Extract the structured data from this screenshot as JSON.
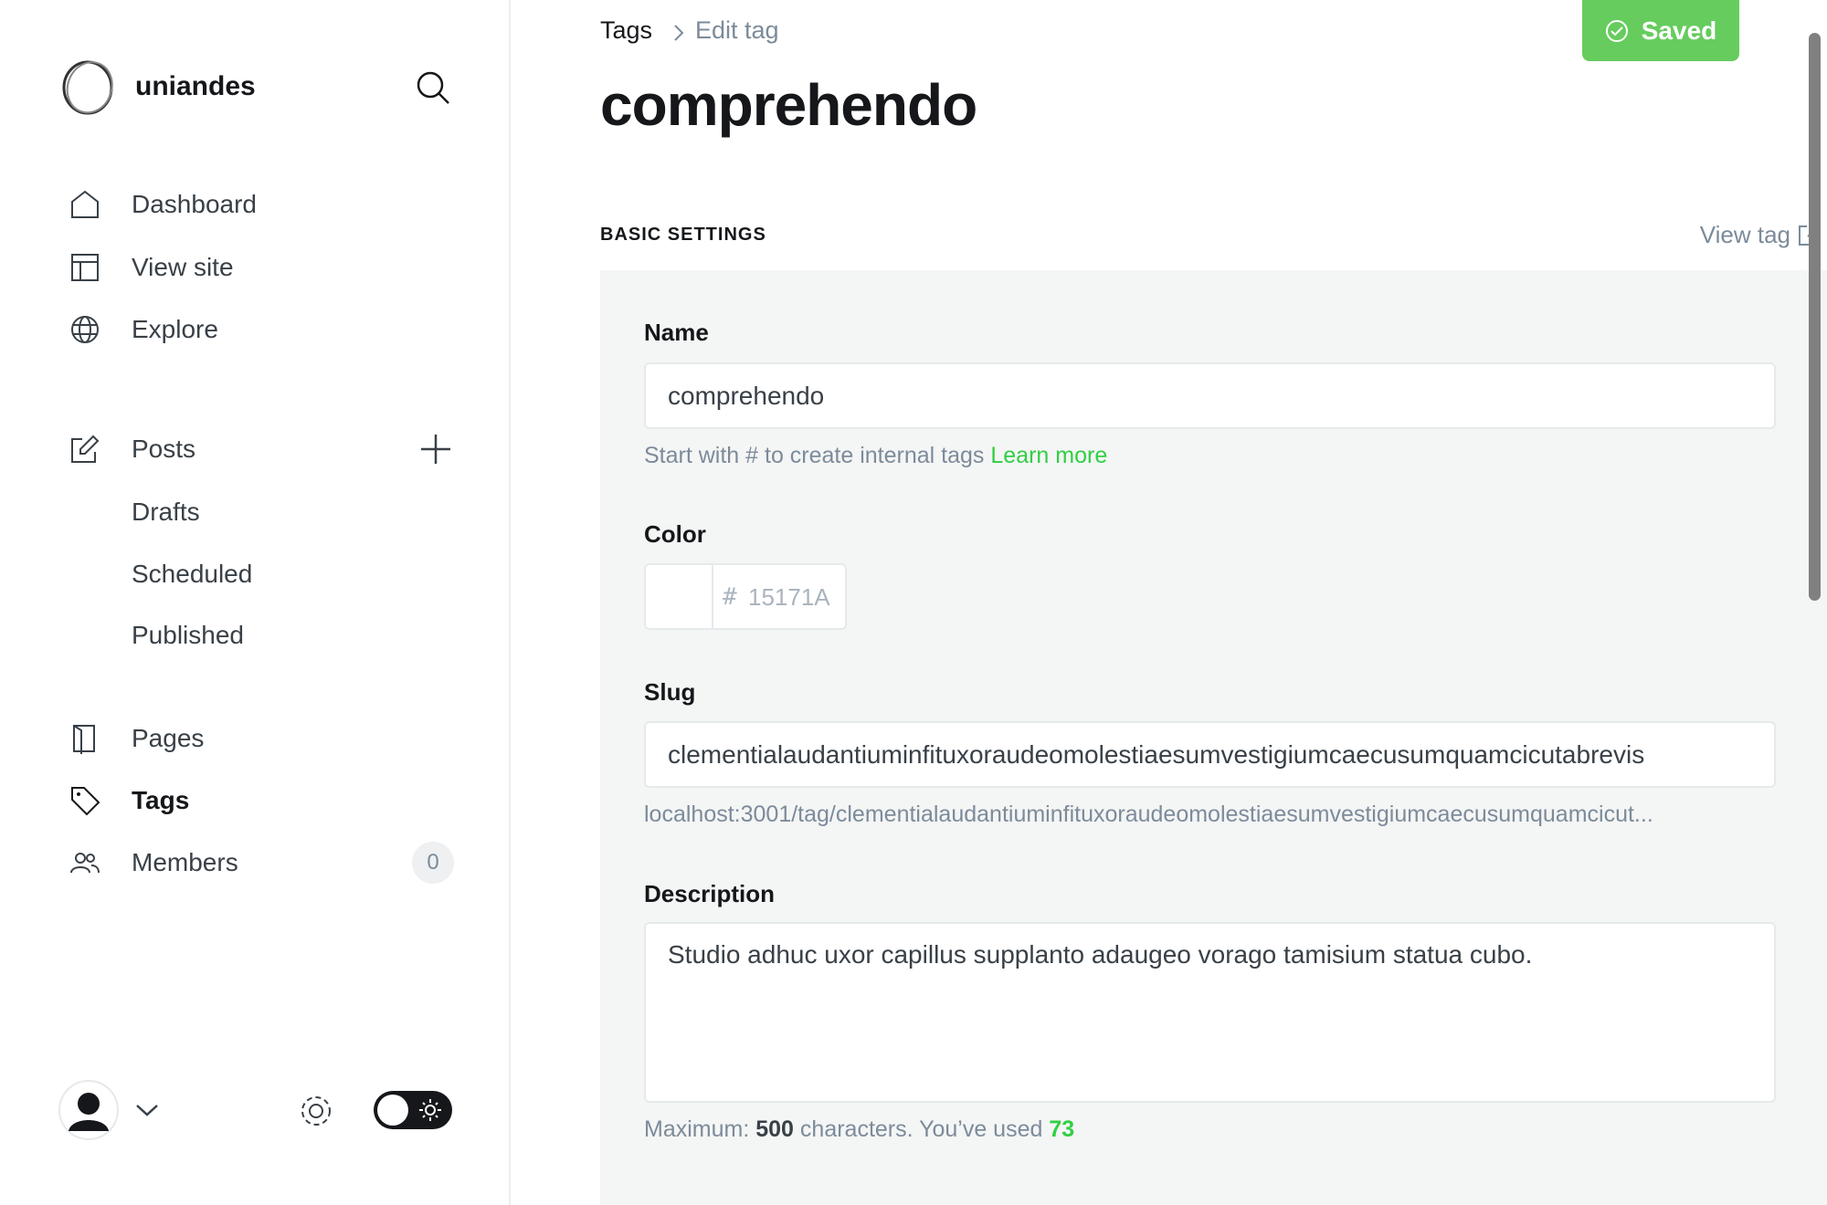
{
  "sidebar": {
    "brand": "uniandes",
    "items": [
      {
        "label": "Dashboard"
      },
      {
        "label": "View site"
      },
      {
        "label": "Explore"
      },
      {
        "label": "Posts"
      },
      {
        "label": "Drafts"
      },
      {
        "label": "Scheduled"
      },
      {
        "label": "Published"
      },
      {
        "label": "Pages"
      },
      {
        "label": "Tags"
      },
      {
        "label": "Members",
        "count": "0"
      }
    ]
  },
  "header": {
    "breadcrumb": [
      "Tags",
      "Edit tag"
    ],
    "title": "comprehendo",
    "saved_label": "Saved"
  },
  "section": {
    "title": "BASIC SETTINGS",
    "view_tag": "View tag"
  },
  "form": {
    "name_label": "Name",
    "name_value": "comprehendo",
    "name_hint": "Start with # to create internal tags",
    "learn_more": "Learn more",
    "color_label": "Color",
    "color_placeholder": "15171A",
    "color_hash": "#",
    "slug_label": "Slug",
    "slug_value": "clementialaudantiuminfituxoraudeomolestiaesumvestigiumcaecusumquamcicutabrevis",
    "slug_url": "localhost:3001/tag/clementialaudantiuminfituxoraudeomolestiaesumvestigiumcaecusumquamcicut...",
    "description_label": "Description",
    "description_value": "Studio adhuc uxor capillus supplanto adaugeo vorago tamisium statua cubo.",
    "max_prefix": "Maximum:",
    "max_value": "500",
    "max_middle": "characters. You’ve used",
    "used_value": "73"
  },
  "colors": {
    "accent": "#30cf43",
    "saved": "#66cc5e",
    "text": "#15171a",
    "muted": "#7c8b9a"
  }
}
